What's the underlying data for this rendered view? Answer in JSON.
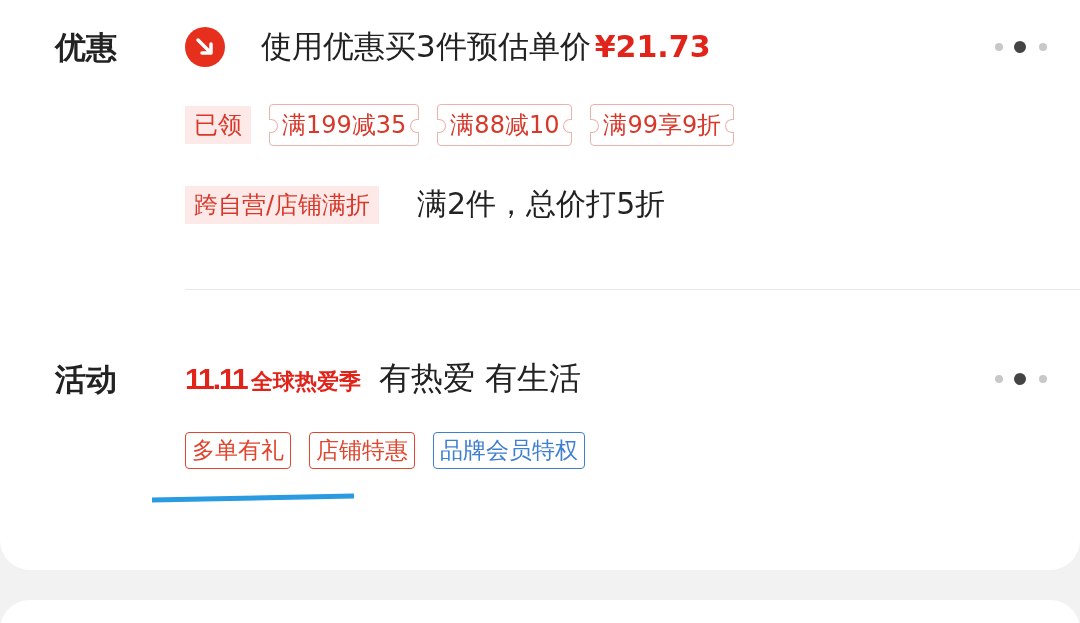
{
  "sections": [
    {
      "kind": "coupon",
      "label": "优惠",
      "headline": {
        "text": "使用优惠买3件预估单价",
        "price": "¥21.73"
      },
      "coupons": [
        {
          "kind": "claimed",
          "text": "已领"
        },
        {
          "kind": "ticket",
          "text": "满199减35"
        },
        {
          "kind": "ticket",
          "text": "满88减10"
        },
        {
          "kind": "ticket",
          "text": "满99享9折"
        }
      ],
      "promo": {
        "tag": "跨自营/店铺满折",
        "text": "满2件，总价打5折"
      }
    },
    {
      "kind": "activity",
      "label": "活动",
      "logo": {
        "mark": "11.11",
        "text": "全球热爱季"
      },
      "slogan": "有热爱 有生活",
      "tags": [
        {
          "text": "多单有礼",
          "color": "#e0452f"
        },
        {
          "text": "店铺特惠",
          "color": "#e0452f"
        },
        {
          "text": "品牌会员特权",
          "color": "#3f7fd0"
        }
      ]
    }
  ]
}
